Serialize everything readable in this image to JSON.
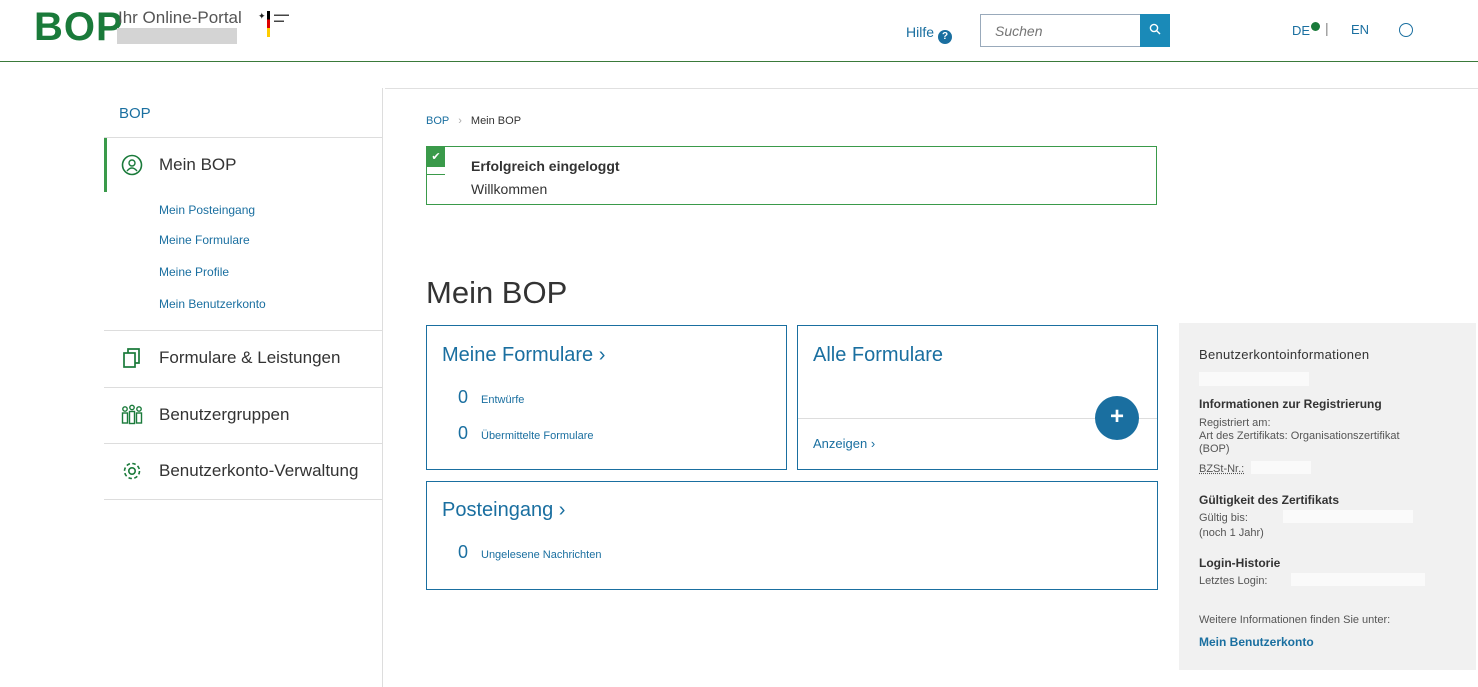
{
  "header": {
    "logo": "BOP",
    "portal_name": "Ihr Online-Portal",
    "help_label": "Hilfe",
    "search_placeholder": "Suchen",
    "lang_de": "DE",
    "lang_en": "EN",
    "icons": {
      "help": "question-circle-icon",
      "search": "search-icon",
      "user": "user-icon"
    }
  },
  "sidebar": {
    "title": "BOP",
    "items": [
      {
        "label": "Mein BOP",
        "icon": "user-circle-icon"
      },
      {
        "label": "Formulare & Leistungen",
        "icon": "copy-icon"
      },
      {
        "label": "Benutzergruppen",
        "icon": "users-icon"
      },
      {
        "label": "Benutzerkonto-Verwaltung",
        "icon": "gear-icon"
      }
    ],
    "subitems": [
      "Mein Posteingang",
      "Meine Formulare",
      "Meine Profile",
      "Mein Benutzerkonto"
    ]
  },
  "breadcrumb": {
    "root": "BOP",
    "current": "Mein BOP"
  },
  "alert": {
    "title": "Erfolgreich eingeloggt",
    "message": "Willkommen"
  },
  "main": {
    "title": "Mein BOP",
    "meine_formulare": {
      "title": "Meine Formulare",
      "rows": [
        {
          "count": "0",
          "label": "Entwürfe"
        },
        {
          "count": "0",
          "label": "Übermittelte Formulare"
        }
      ]
    },
    "alle_formulare": {
      "title": "Alle Formulare",
      "link": "Anzeigen"
    },
    "posteingang": {
      "title": "Posteingang",
      "rows": [
        {
          "count": "0",
          "label": "Ungelesene Nachrichten"
        }
      ]
    }
  },
  "info": {
    "heading": "Benutzerkontoinformationen",
    "reg_title": "Informationen zur Registrierung",
    "reg_date_label": "Registriert am:",
    "cert_type_label": "Art des Zertifikats: Organisationszertifikat",
    "cert_type_suffix": "(BOP)",
    "bzst_label": "BZSt-Nr.:",
    "valid_title": "Gültigkeit des Zertifikats",
    "valid_until_label": "Gültig bis:",
    "valid_remaining": "(noch 1 Jahr)",
    "login_title": "Login-Historie",
    "last_login_label": "Letztes Login:",
    "more_info": "Weitere Informationen finden Sie unter:",
    "link": "Mein Benutzerkonto"
  },
  "colors": {
    "brand_green": "#1a7a3a",
    "link_blue": "#1a6fa0",
    "accent_blue": "#1a8ab8"
  }
}
